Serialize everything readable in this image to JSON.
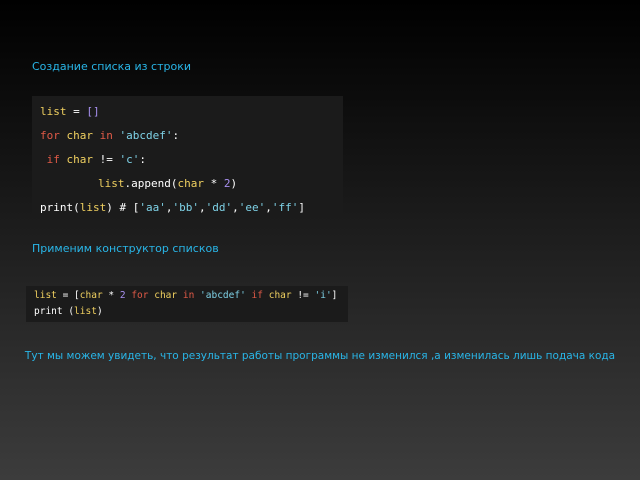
{
  "heading1": "Создание списка из строки",
  "heading2": "Применим конструктор списков",
  "note": "Тут мы можем увидеть, что результат работы программы не изменился ,а изменилась лишь подача кода",
  "code1": {
    "l1": [
      "list",
      " = ",
      "[]"
    ],
    "l2": [
      "for",
      " ",
      "char",
      " ",
      "in",
      " ",
      "'abcdef'",
      ":"
    ],
    "l3": [
      " if",
      " ",
      "char",
      " != ",
      "'c'",
      ":"
    ],
    "l4": [
      "list",
      ".append(",
      "char",
      " * ",
      "2",
      ")"
    ],
    "l5": [
      "print(",
      "list",
      ") # [",
      "'aa'",
      ",",
      "'bb'",
      ",",
      "'dd'",
      ",",
      "'ee'",
      ",",
      "'ff'",
      "]"
    ]
  },
  "code2": {
    "l1": [
      "list",
      " = [",
      "char",
      " * ",
      "2",
      " ",
      "for",
      " ",
      "char",
      " ",
      "in",
      " ",
      "'abcdef'",
      " ",
      "if",
      " ",
      "char",
      " != ",
      "'i'",
      "]"
    ],
    "l2": [
      "print (",
      "list",
      ")"
    ]
  }
}
